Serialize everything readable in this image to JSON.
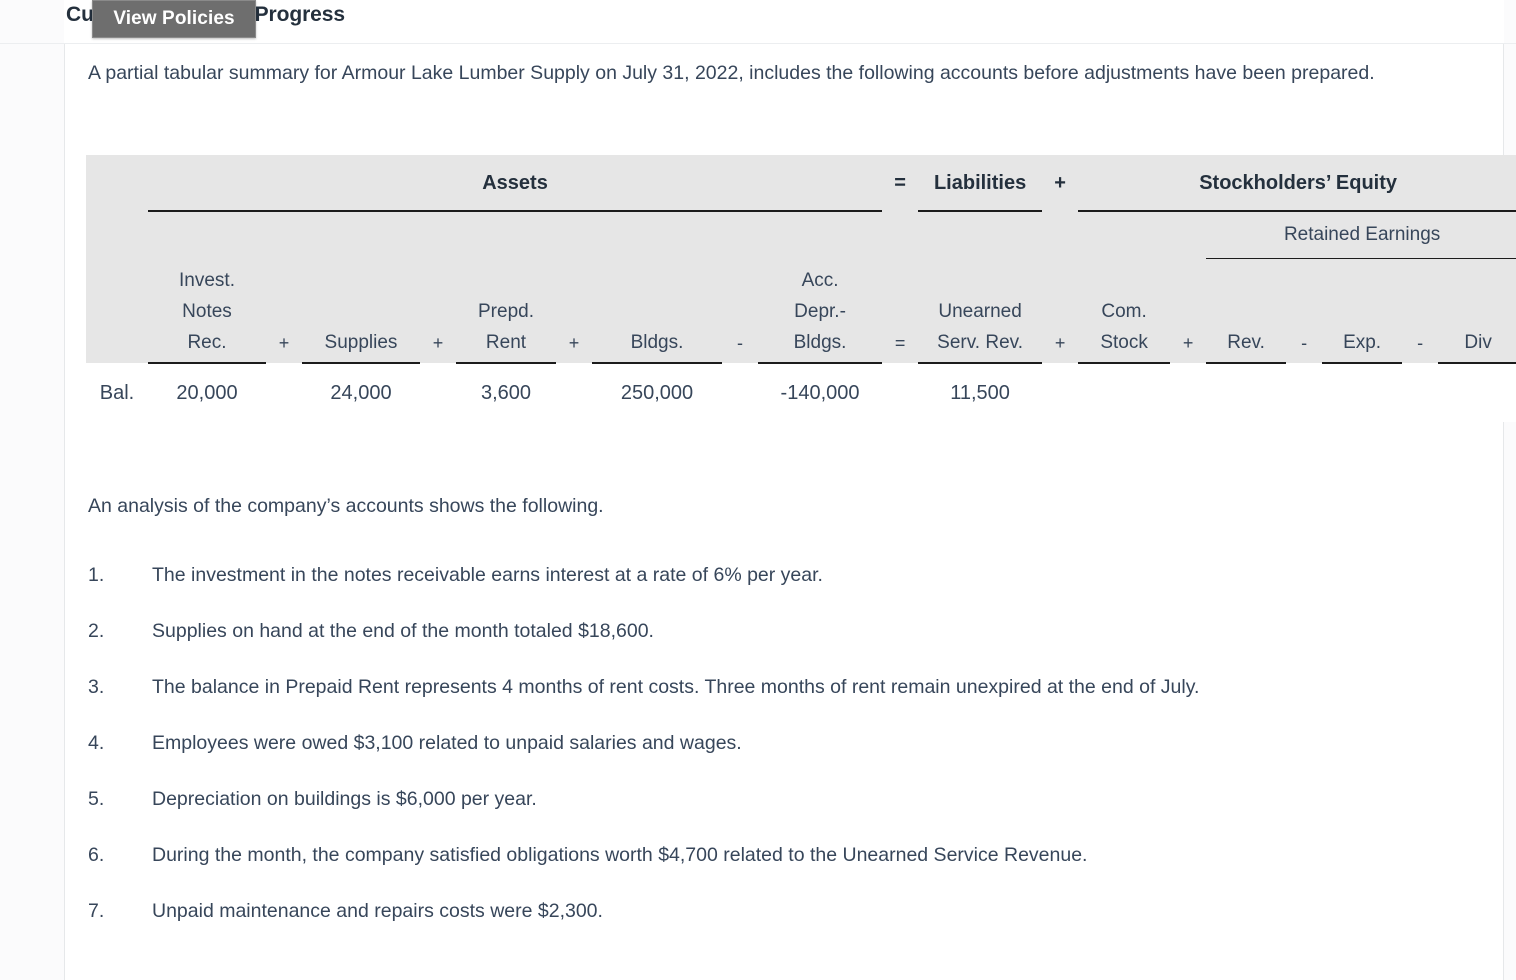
{
  "header": {
    "title": "Current Attempt in Progress",
    "tooltip_label": "View Policies"
  },
  "intro": {
    "paragraph": "A partial tabular summary for Armour Lake Lumber Supply on July 31, 2022, includes the following accounts before adjustments have been prepared."
  },
  "equation_table": {
    "groups": {
      "assets": "Assets",
      "eq_sign_1": "=",
      "liabilities": "Liabilities",
      "plus_sign_1": "+",
      "stockholders_equity": "Stockholders’ Equity"
    },
    "subgroups": {
      "retained_earnings": "Retained Earnings"
    },
    "columns": [
      {
        "key": "invest_notes_rec",
        "lines": [
          "Invest.",
          "Notes",
          "Rec."
        ],
        "op_before": ""
      },
      {
        "key": "supplies",
        "lines": [
          "Supplies"
        ],
        "op_before": "+"
      },
      {
        "key": "prepd_rent",
        "lines": [
          "Prepd.",
          "Rent"
        ],
        "op_before": "+"
      },
      {
        "key": "bldgs",
        "lines": [
          "Bldgs."
        ],
        "op_before": "+"
      },
      {
        "key": "acc_depr_bldgs",
        "lines": [
          "Acc.",
          "Depr.-",
          "Bldgs."
        ],
        "op_before": "-"
      },
      {
        "key": "unearned_serv_rev",
        "lines": [
          "Unearned",
          "Serv. Rev."
        ],
        "op_before": "="
      },
      {
        "key": "com_stock",
        "lines": [
          "Com.",
          "Stock"
        ],
        "op_before": "+"
      },
      {
        "key": "rev",
        "lines": [
          "Rev."
        ],
        "op_before": "+"
      },
      {
        "key": "exp",
        "lines": [
          "Exp."
        ],
        "op_before": "-"
      },
      {
        "key": "div",
        "lines": [
          "Div"
        ],
        "op_before": "-"
      }
    ],
    "rows": [
      {
        "label": "Bal.",
        "values": {
          "invest_notes_rec": "20,000",
          "supplies": "24,000",
          "prepd_rent": "3,600",
          "bldgs": "250,000",
          "acc_depr_bldgs": "-140,000",
          "unearned_serv_rev": "11,500",
          "com_stock": "",
          "rev": "",
          "exp": "",
          "div": ""
        }
      }
    ]
  },
  "analysis": {
    "lead_in": "An analysis of the company’s accounts shows the following.",
    "items": [
      {
        "num": "1.",
        "text": "The investment in the notes receivable earns interest at a rate of 6% per year."
      },
      {
        "num": "2.",
        "text": "Supplies on hand at the end of the month totaled $18,600."
      },
      {
        "num": "3.",
        "text": "The balance in Prepaid Rent represents 4 months of rent costs. Three months of rent remain unexpired at the end of July."
      },
      {
        "num": "4.",
        "text": "Employees were owed $3,100 related to unpaid salaries and wages."
      },
      {
        "num": "5.",
        "text": "Depreciation on buildings is $6,000 per year."
      },
      {
        "num": "6.",
        "text": "During the month, the company satisfied obligations worth $4,700 related to the Unearned Service Revenue."
      },
      {
        "num": "7.",
        "text": "Unpaid maintenance and repairs costs were $2,300."
      }
    ]
  },
  "colors": {
    "table_header_bg": "#e6e6e6",
    "text": "#37465a",
    "tooltip_bg": "#6e6e6e",
    "rule": "#1c1c1c"
  }
}
